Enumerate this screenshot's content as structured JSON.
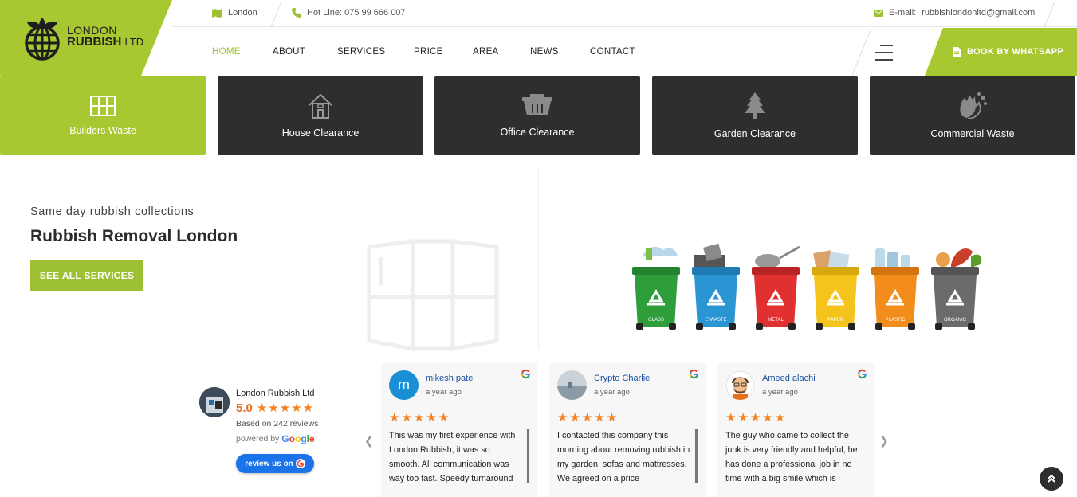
{
  "logo": {
    "line1": "LONDON",
    "line2": "RUBBISH",
    "line2b": "LTD"
  },
  "topbar": {
    "location": "London",
    "hotline": "Hot Line:  075 99 666 007",
    "email_label": "E-mail:",
    "email": "rubbishlondonltd@gmail.com"
  },
  "nav": {
    "items": [
      "HOME",
      "ABOUT",
      "SERVICES",
      "PRICE",
      "AREA",
      "NEWS",
      "CONTACT"
    ],
    "active": "HOME",
    "book_label": "BOOK BY WHATSAPP"
  },
  "services": [
    {
      "label": "Builders Waste",
      "icon": "builders-waste-icon",
      "active": true
    },
    {
      "label": "House Clearance",
      "icon": "house-icon",
      "active": false
    },
    {
      "label": "Office Clearance",
      "icon": "office-skip-icon",
      "active": false
    },
    {
      "label": "Garden Clearance",
      "icon": "tree-icon",
      "active": false
    },
    {
      "label": "Commercial Waste",
      "icon": "hand-wash-icon",
      "active": false
    }
  ],
  "hero": {
    "subtitle": "Same day rubbish collections",
    "title": "Rubbish Removal London",
    "button": "SEE ALL SERVICES"
  },
  "bins": [
    {
      "label": "GLASS",
      "color": "#2e9e3a"
    },
    {
      "label": "E-WASTE",
      "color": "#2a95d3"
    },
    {
      "label": "METAL",
      "color": "#e03030"
    },
    {
      "label": "PAPER",
      "color": "#f5c41c"
    },
    {
      "label": "PLASTIC",
      "color": "#f28c1b"
    },
    {
      "label": "ORGANIC",
      "color": "#6b6b6b"
    }
  ],
  "reviews_summary": {
    "name": "London Rubbish Ltd",
    "rating": "5.0",
    "stars": "★★★★★",
    "based_on": "Based on 242 reviews",
    "powered_by": "powered by",
    "google": "Google",
    "review_us": "review us on"
  },
  "reviews": [
    {
      "name": "mikesh patel",
      "time": "a year ago",
      "stars": "★★★★★",
      "initial": "m",
      "text": "This was my first experience with London Rubbish, it was so smooth. All communication was way too fast. Speedy turnaround"
    },
    {
      "name": "Crypto Charlie",
      "time": "a year ago",
      "stars": "★★★★★",
      "initial": "",
      "text": "I contacted this company this morning about removing rubbish in my garden, sofas and mattresses. We agreed on a price"
    },
    {
      "name": "Ameed alachi",
      "time": "a year ago",
      "stars": "★★★★★",
      "initial": "",
      "text": "The guy who came to collect the junk is very friendly and helpful, he has done a professional job in no time with a big smile which is"
    }
  ],
  "colors": {
    "accent": "#a8c832",
    "dark": "#2e2e2e"
  }
}
